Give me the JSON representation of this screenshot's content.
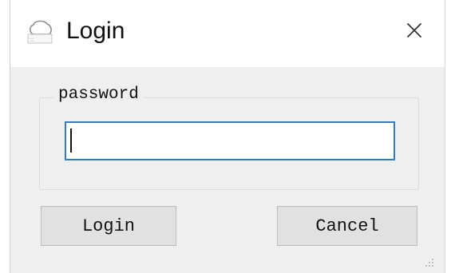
{
  "window": {
    "title": "Login"
  },
  "icons": {
    "app": "app-icon",
    "close": "close-icon",
    "grip": "resize-grip-icon"
  },
  "form": {
    "group_label": "password",
    "password_value": "",
    "login_label": "Login",
    "cancel_label": "Cancel"
  },
  "colors": {
    "input_focus_border": "#2f7bc8",
    "button_bg": "#e1e1e1",
    "window_bg": "#efefef"
  }
}
